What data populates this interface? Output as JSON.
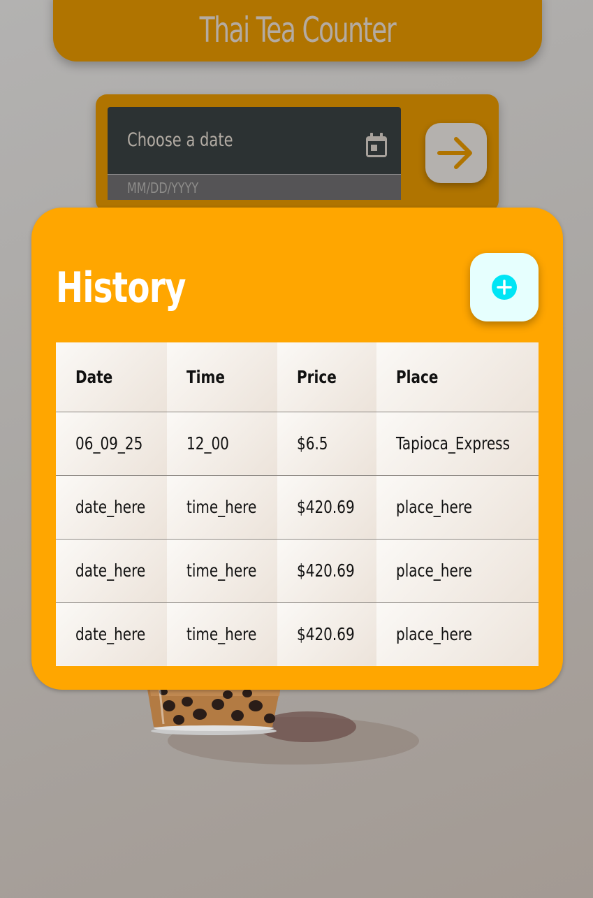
{
  "header": {
    "title": "Thai Tea Counter"
  },
  "date_picker": {
    "label": "Choose a date",
    "placeholder": "MM/DD/YYYY",
    "calendar_icon": "calendar-icon",
    "submit_icon": "arrow-right-icon"
  },
  "history": {
    "title": "History",
    "add_icon": "plus-circle-icon",
    "columns": [
      "Date",
      "Time",
      "Price",
      "Place"
    ],
    "rows": [
      [
        "06_09_25",
        "12_00",
        "$6.5",
        "Tapioca_Express"
      ],
      [
        "date_here",
        "time_here",
        "$420.69",
        "place_here"
      ],
      [
        "date_here",
        "time_here",
        "$420.69",
        "place_here"
      ],
      [
        "date_here",
        "time_here",
        "$420.69",
        "place_here"
      ]
    ]
  },
  "colors": {
    "header_bg": "#b07400",
    "card_bg": "#ffa600",
    "accent_cyan": "#00e5f5",
    "arrow": "#b07400"
  }
}
